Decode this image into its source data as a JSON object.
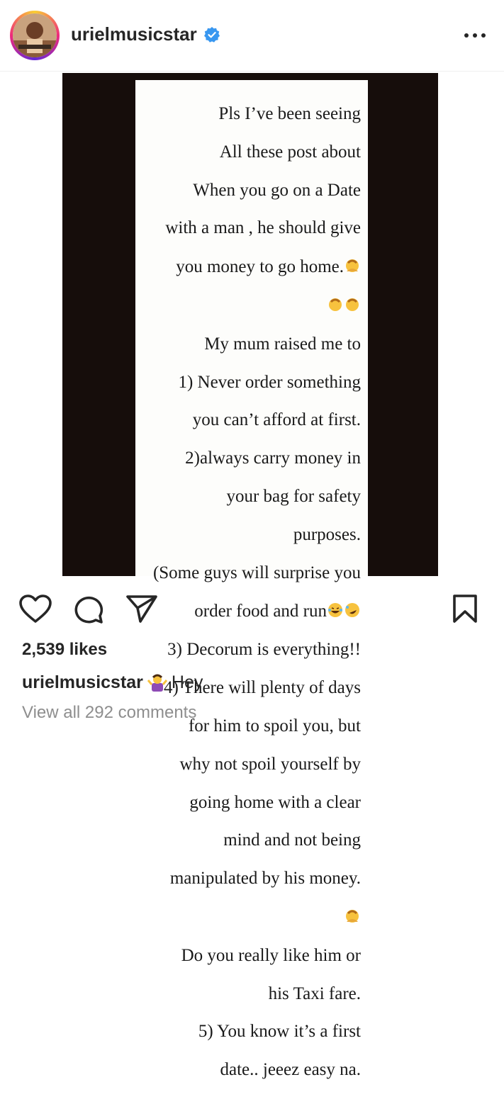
{
  "header": {
    "username": "urielmusicstar",
    "verified_icon": "verified-badge-icon",
    "more_icon": "more-options-icon"
  },
  "post": {
    "note_lines": [
      "Pls I’ve been seeing",
      "All these post about",
      "When you go on a Date",
      "with a man , he should give",
      "you money to go home.",
      "",
      "My mum raised me to",
      "1) Never order something",
      "you can’t afford at first.",
      "2)always carry money in",
      "your bag for safety",
      "purposes.",
      "(Some guys will surprise you",
      "order food and run",
      "3) Decorum is everything!!",
      "4) There will plenty of days",
      "for him  to spoil you, but",
      "why not spoil yourself by",
      "going home with a clear",
      "mind and not being",
      "manipulated by his money.",
      "",
      "Do you really like him or",
      "his Taxi fare.",
      "5)  You know it’s a first",
      "date.. jeeez  easy na."
    ]
  },
  "actions": {
    "like_icon": "heart-icon",
    "comment_icon": "comment-icon",
    "share_icon": "share-icon",
    "save_icon": "bookmark-icon"
  },
  "likes_text": "2,539 likes",
  "caption": {
    "username": "urielmusicstar",
    "emoji": "shrug-emoji",
    "text": "Hey"
  },
  "comments_link": "View all 292 comments"
}
